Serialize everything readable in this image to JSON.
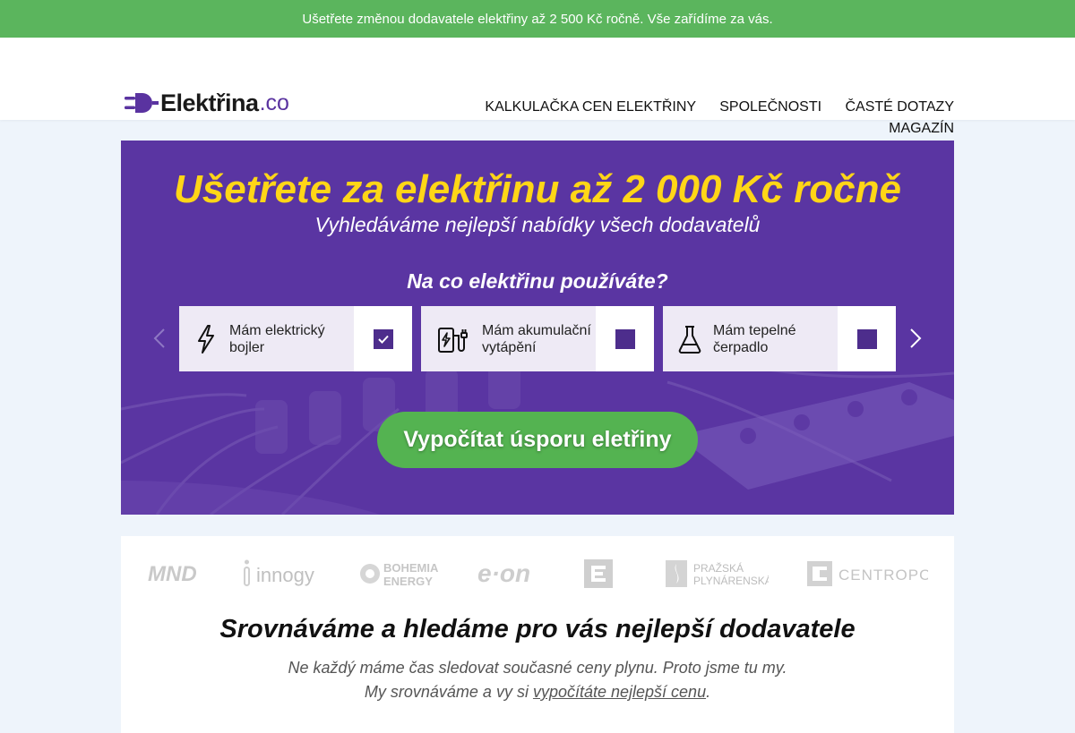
{
  "topbar": {
    "text": "Ušetřete změnou dodavatele elektřiny až 2 500 Kč ročně. Vše zařídíme za vás."
  },
  "logo": {
    "name": "Elektřina",
    "tld": ".co"
  },
  "nav": {
    "items": [
      "KALKULAČKA CEN ELEKTŘINY",
      "SPOLEČNOSTI",
      "ČASTÉ DOTAZY",
      "MAGAZÍN"
    ]
  },
  "hero": {
    "title": "Ušetřete za elektřinu až 2 000 Kč ročně",
    "subtitle": "Vyhledáváme nejlepší nabídky všech dodavatelů",
    "question": "Na co elektřinu používáte?",
    "cards": [
      {
        "label": "Mám elektrický bojler",
        "icon": "lightning-icon",
        "checked": true
      },
      {
        "label": "Mám akumulační vytápění",
        "icon": "ev-charger-icon",
        "checked": false
      },
      {
        "label": "Mám tepelné čerpadlo",
        "icon": "flask-icon",
        "checked": false
      }
    ],
    "cta_label": "Vypočítat úsporu eletřiny"
  },
  "brands": [
    "MND",
    "innogy",
    "BOHEMIA ENERGY",
    "e·on",
    "ČEZ",
    "PRAŽSKÁ PLYNÁRENSKÁ",
    "CENTROPOL"
  ],
  "brand_texts": {
    "mnd": "MND",
    "innogy": "innogy",
    "bohemia_1": "BOHEMIA",
    "bohemia_2": "ENERGY",
    "eon": "e·on",
    "pp_1": "PRAŽSKÁ",
    "pp_2": "PLYNÁRENSKÁ",
    "centropol": "CENTROPOL"
  },
  "section": {
    "title": "Srovnáváme a hledáme pro vás nejlepší dodavatele",
    "line1": "Ne každý máme čas sledovat současné ceny plynu. Proto jsme tu my.",
    "line2_prefix": "My srovnáváme a vy si ",
    "line2_link": "vypočítáte nejlepší cenu",
    "line2_suffix": "."
  },
  "colors": {
    "topbar": "#5bb55d",
    "hero_bg": "#5a35a2",
    "title_yellow": "#ffd617",
    "cta_green": "#54b351",
    "checkbox_purple": "#4d2d8c"
  }
}
